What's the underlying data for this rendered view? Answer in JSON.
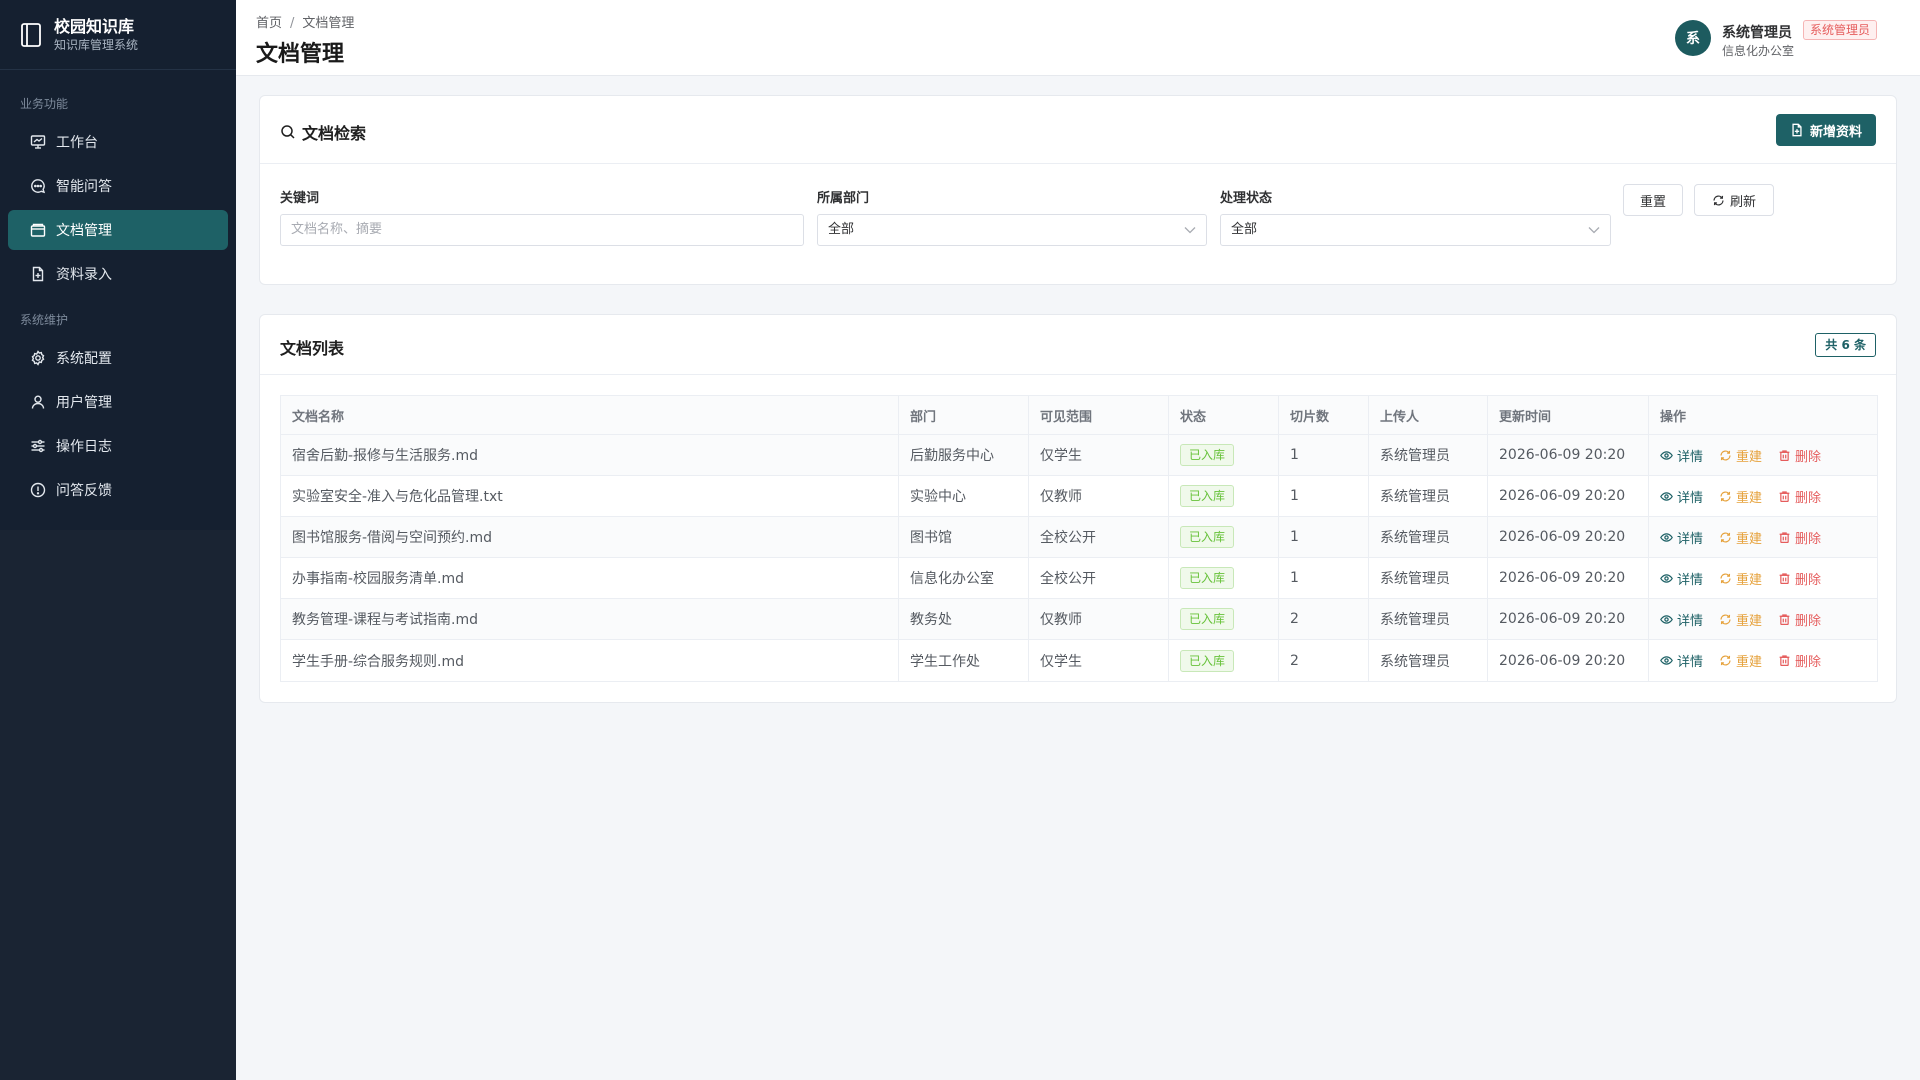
{
  "brand": {
    "title": "校园知识库",
    "subtitle": "知识库管理系统"
  },
  "sidebar": {
    "groups": [
      {
        "label": "业务功能",
        "items": [
          {
            "label": "工作台",
            "icon": "dashboard-icon"
          },
          {
            "label": "智能问答",
            "icon": "chat-icon"
          },
          {
            "label": "文档管理",
            "icon": "folder-icon",
            "active": true
          },
          {
            "label": "资料录入",
            "icon": "file-add-icon"
          }
        ]
      },
      {
        "label": "系统维护",
        "items": [
          {
            "label": "系统配置",
            "icon": "gear-icon"
          },
          {
            "label": "用户管理",
            "icon": "user-icon"
          },
          {
            "label": "操作日志",
            "icon": "sliders-icon"
          },
          {
            "label": "问答反馈",
            "icon": "info-icon"
          }
        ]
      }
    ]
  },
  "header": {
    "breadcrumb": [
      "首页",
      "文档管理"
    ],
    "breadcrumb_sep": "/",
    "title": "文档管理",
    "user": {
      "avatar": "系",
      "name": "系统管理员",
      "role": "系统管理员",
      "dept": "信息化办公室"
    }
  },
  "search": {
    "title": "文档检索",
    "add_button": "新增资料",
    "keyword_label": "关键词",
    "keyword_placeholder": "文档名称、摘要",
    "dept_label": "所属部门",
    "dept_value": "全部",
    "status_label": "处理状态",
    "status_value": "全部",
    "reset_button": "重置",
    "refresh_button": "刷新"
  },
  "list": {
    "title": "文档列表",
    "count": "共 6 条",
    "columns": [
      "文档名称",
      "部门",
      "可见范围",
      "状态",
      "切片数",
      "上传人",
      "更新时间",
      "操作"
    ],
    "actions": {
      "view": "详情",
      "rebuild": "重建",
      "delete": "删除"
    },
    "rows": [
      {
        "name": "宿舍后勤-报修与生活服务.md",
        "dept": "后勤服务中心",
        "scope": "仅学生",
        "status": "已入库",
        "chunks": "1",
        "uploader": "系统管理员",
        "updated": "2026-06-09 20:20"
      },
      {
        "name": "实验室安全-准入与危化品管理.txt",
        "dept": "实验中心",
        "scope": "仅教师",
        "status": "已入库",
        "chunks": "1",
        "uploader": "系统管理员",
        "updated": "2026-06-09 20:20"
      },
      {
        "name": "图书馆服务-借阅与空间预约.md",
        "dept": "图书馆",
        "scope": "全校公开",
        "status": "已入库",
        "chunks": "1",
        "uploader": "系统管理员",
        "updated": "2026-06-09 20:20"
      },
      {
        "name": "办事指南-校园服务清单.md",
        "dept": "信息化办公室",
        "scope": "全校公开",
        "status": "已入库",
        "chunks": "1",
        "uploader": "系统管理员",
        "updated": "2026-06-09 20:20"
      },
      {
        "name": "教务管理-课程与考试指南.md",
        "dept": "教务处",
        "scope": "仅教师",
        "status": "已入库",
        "chunks": "2",
        "uploader": "系统管理员",
        "updated": "2026-06-09 20:20"
      },
      {
        "name": "学生手册-综合服务规则.md",
        "dept": "学生工作处",
        "scope": "仅学生",
        "status": "已入库",
        "chunks": "2",
        "uploader": "系统管理员",
        "updated": "2026-06-09 20:20"
      }
    ]
  },
  "colors": {
    "accent": "#1e6166",
    "sidebar_bg": "#1a2433",
    "success": "#67c23a",
    "warning": "#e6a23c",
    "danger": "#e55c5c"
  }
}
